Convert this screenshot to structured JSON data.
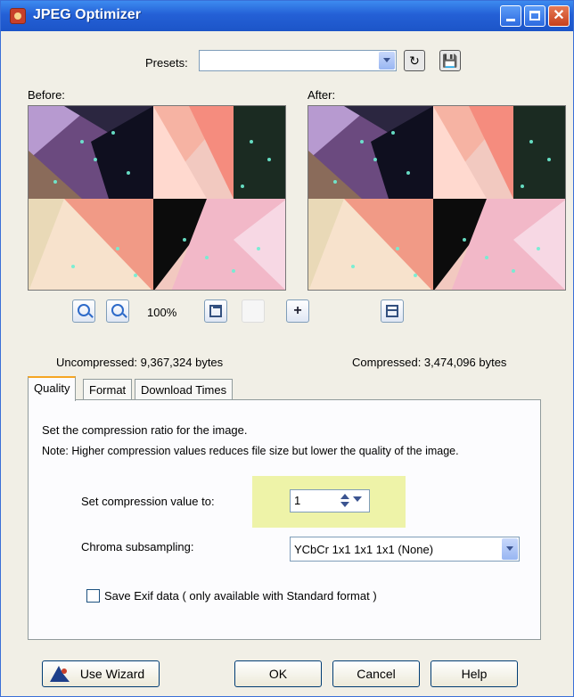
{
  "window": {
    "title": "JPEG Optimizer",
    "controls": {
      "minimize": "minimize-icon",
      "maximize": "maximize-icon",
      "close": "close-icon"
    }
  },
  "presets": {
    "label": "Presets:",
    "value": "",
    "icons": {
      "reset": "reset-icon",
      "save": "save-preset-icon"
    }
  },
  "previews": {
    "before_label": "Before:",
    "after_label": "After:",
    "zoom_level": "100%",
    "tools": {
      "zoom_in": "zoom-in-icon",
      "zoom_out": "zoom-out-icon",
      "fit": "zoom-to-fit-icon",
      "pan": "pan-icon",
      "split": "proof-window-icon"
    }
  },
  "stats": {
    "uncompressed": "Uncompressed: 9,367,324 bytes",
    "compressed": "Compressed: 3,474,096 bytes"
  },
  "tabs": [
    {
      "label": "Quality",
      "active": true
    },
    {
      "label": "Format",
      "active": false
    },
    {
      "label": "Download Times",
      "active": false
    }
  ],
  "quality": {
    "description": "Set the compression ratio for the image.",
    "note": "Note: Higher compression values reduces file size but lower the quality of the image.",
    "compression_label": "Set compression value to:",
    "compression_value": "1",
    "chroma_label": "Chroma subsampling:",
    "chroma_value": "YCbCr 1x1 1x1 1x1 (None)",
    "exif_label": "Save Exif data ( only available with Standard format )",
    "exif_checked": false
  },
  "buttons": {
    "wizard": "Use Wizard",
    "ok": "OK",
    "cancel": "Cancel",
    "help": "Help"
  },
  "colors": {
    "titlebar": "#2460d6",
    "dialog_bg": "#f1efe6",
    "highlight": "#eef3a8",
    "active_tab_accent": "#f5a623"
  }
}
